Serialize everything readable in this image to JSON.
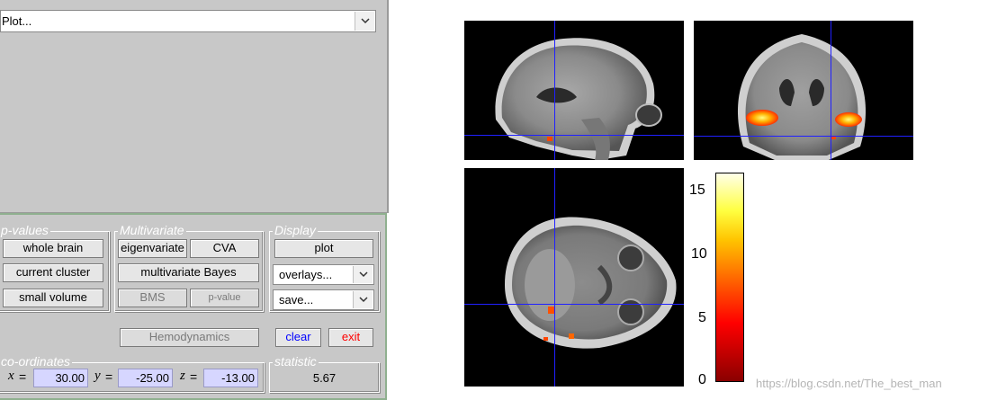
{
  "plot_menu": {
    "value": "Plot..."
  },
  "pvalues": {
    "title": "p-values",
    "whole_brain": "whole brain",
    "current_cluster": "current cluster",
    "small_volume": "small volume"
  },
  "multivariate": {
    "title": "Multivariate",
    "eigenvariate": "eigenvariate",
    "cva": "CVA",
    "multivariate_bayes": "multivariate Bayes",
    "bms": "BMS",
    "pvalue": "p-value"
  },
  "display": {
    "title": "Display",
    "plot": "plot",
    "overlays": "overlays...",
    "save": "save..."
  },
  "hemodynamics": "Hemodynamics",
  "clear": "clear",
  "exit": "exit",
  "coordinates": {
    "title": "co-ordinates",
    "x_label": "x",
    "x_value": "30.00",
    "y_label": "y",
    "y_value": "-25.00",
    "z_label": "z",
    "z_value": "-13.00",
    "eq": "="
  },
  "statistic": {
    "title": "statistic",
    "value": "5.67"
  },
  "colorbar": {
    "ticks": [
      "15",
      "10",
      "5",
      "0"
    ],
    "range": [
      0,
      16.6
    ]
  },
  "watermark": "https://blog.csdn.net/The_best_man",
  "colors": {
    "crosshair": "#2020ff",
    "coord_input_bg": "#d6d6ff",
    "panel_bg": "#c8c8c8",
    "results_border": "#8fb08f"
  }
}
